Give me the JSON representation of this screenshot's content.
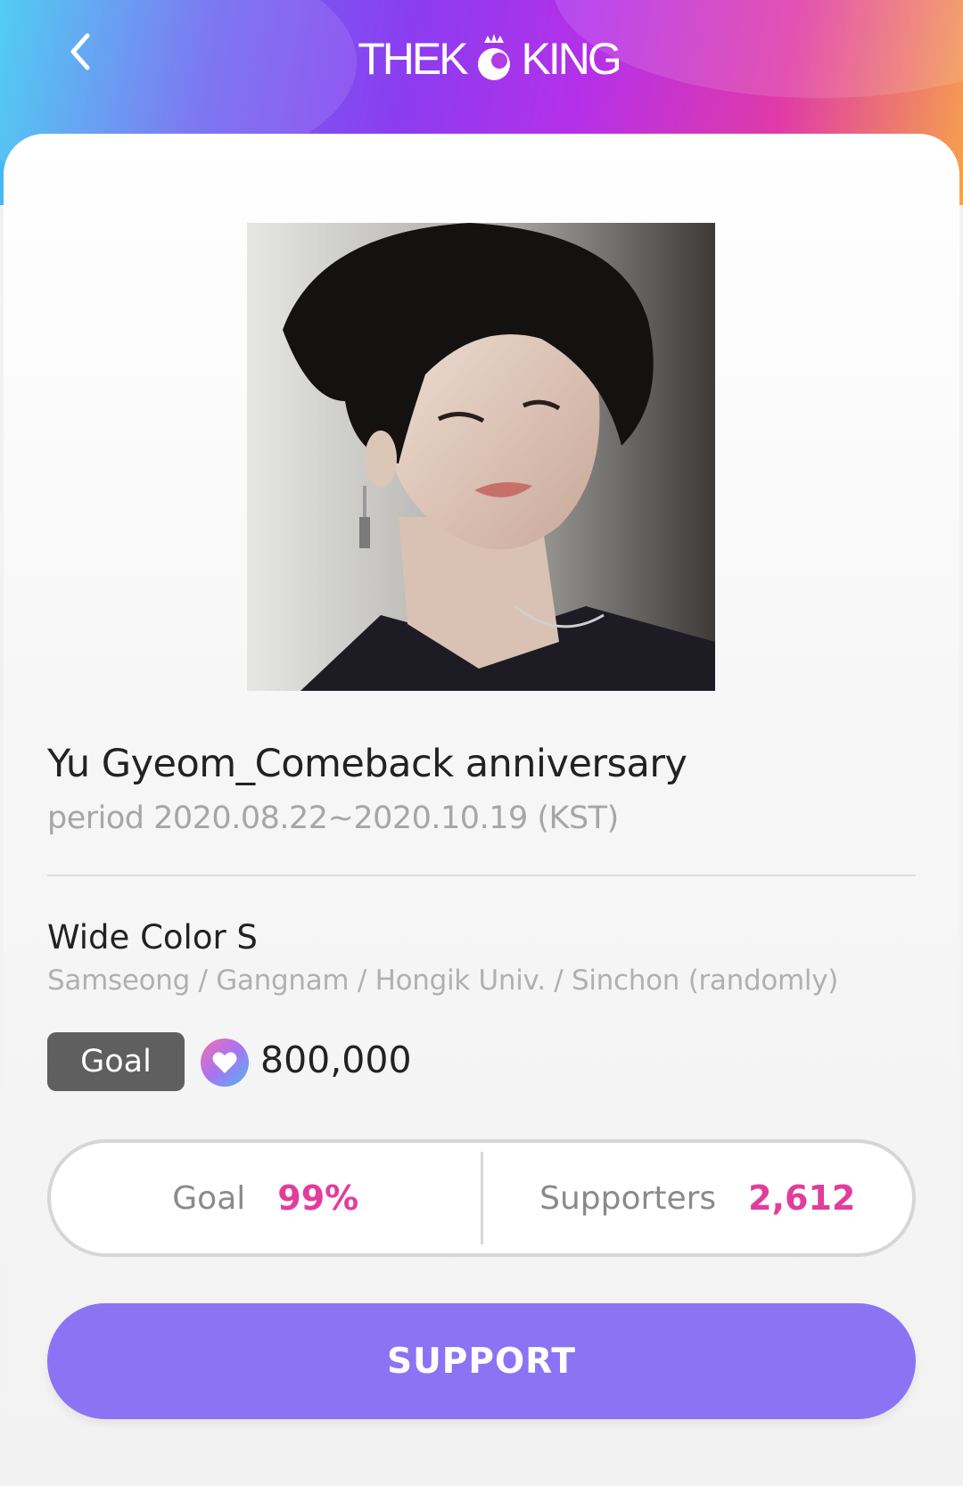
{
  "header": {
    "logo_left": "THEK",
    "logo_right": "KING"
  },
  "project": {
    "title": "Yu Gyeom_Comeback anniversary",
    "period": "period 2020.08.22~2020.10.19 (KST)",
    "product": "Wide Color S",
    "locations": "Samseong / Gangnam / Hongik Univ. / Sinchon (randomly)",
    "goal_badge": "Goal",
    "goal_amount": "800,000"
  },
  "stats": {
    "goal_label": "Goal",
    "goal_value": "99%",
    "supporters_label": "Supporters",
    "supporters_value": "2,612"
  },
  "actions": {
    "support_label": "SUPPORT"
  },
  "icons": {
    "back": "chevron-left-icon",
    "heart": "heart-icon",
    "logo_emblem": "crown-emblem-icon"
  },
  "colors": {
    "accent_pink": "#e23d9c",
    "support_button": "#8a74f3",
    "goal_badge": "#5f5f5f"
  }
}
